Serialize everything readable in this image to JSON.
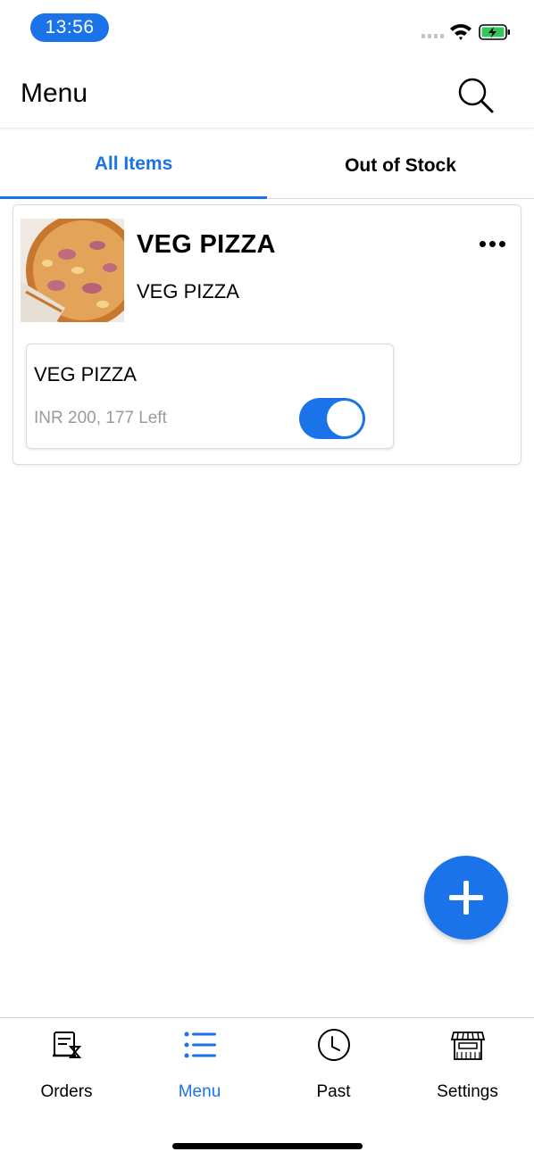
{
  "status_bar": {
    "time": "13:56"
  },
  "header": {
    "title": "Menu",
    "search_icon": "search-icon"
  },
  "tabs": [
    {
      "label": "All Items",
      "active": true
    },
    {
      "label": "Out of Stock",
      "active": false
    }
  ],
  "item": {
    "title": "VEG PIZZA",
    "subtitle": "VEG PIZZA",
    "variant": {
      "name": "VEG PIZZA",
      "meta": "INR 200, 177 Left",
      "in_stock": true
    }
  },
  "bottom_nav": [
    {
      "label": "Orders",
      "icon": "orders-icon",
      "active": false
    },
    {
      "label": "Menu",
      "icon": "menu-list-icon",
      "active": true
    },
    {
      "label": "Past",
      "icon": "clock-icon",
      "active": false
    },
    {
      "label": "Settings",
      "icon": "store-icon",
      "active": false
    }
  ],
  "colors": {
    "accent": "#1a73e8",
    "muted_text": "#9b9b9b"
  }
}
